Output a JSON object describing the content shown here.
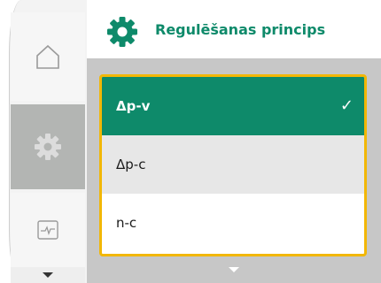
{
  "header": {
    "title": "Regulēšanas princips",
    "icon": "gear-icon"
  },
  "sidebar": {
    "items": [
      {
        "name": "home",
        "icon": "home-icon",
        "active": false
      },
      {
        "name": "settings",
        "icon": "gear-icon",
        "active": true
      },
      {
        "name": "monitor",
        "icon": "pulse-monitor-icon",
        "active": false
      }
    ],
    "scroll_icon": "chevron-down-icon"
  },
  "options": [
    {
      "label": "Δp-v",
      "selected": true
    },
    {
      "label": "Δp-c",
      "selected": false
    },
    {
      "label": "n-c",
      "selected": false
    }
  ],
  "colors": {
    "accent": "#0e8a6a",
    "focus": "#f2b705",
    "background": "#c7c7c7"
  }
}
